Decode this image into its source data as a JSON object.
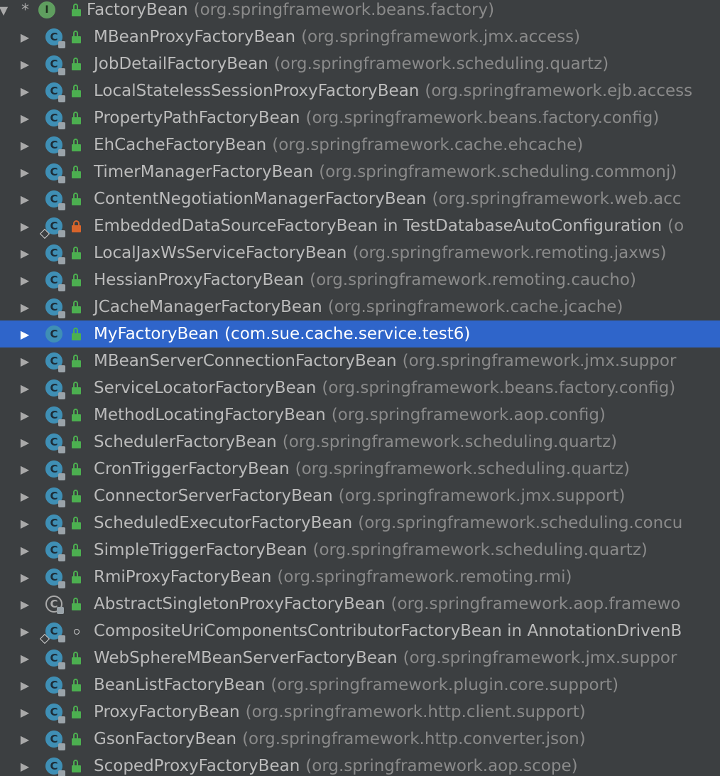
{
  "colors": {
    "background": "#3c3f41",
    "selection": "#2f65ca",
    "text": "#bbbbbb",
    "package_text": "#8a8a8a",
    "class_icon": "#3f8fb5",
    "interface_icon": "#5f9e5f",
    "public_lock": "#4caf50",
    "private_lock": "#d8642b"
  },
  "root": {
    "expand_icon": "chevron-down-icon",
    "marker": "*",
    "icon": "interface-icon",
    "icon_letter": "I",
    "visibility": "public",
    "name": "FactoryBean",
    "pkg": "(org.springframework.beans.factory)"
  },
  "rows": [
    {
      "name": "MBeanProxyFactoryBean",
      "pkg": "(org.springframework.jmx.access)",
      "icon": "class",
      "visibility": "public"
    },
    {
      "name": "JobDetailFactoryBean",
      "pkg": "(org.springframework.scheduling.quartz)",
      "icon": "class",
      "visibility": "public"
    },
    {
      "name": "LocalStatelessSessionProxyFactoryBean",
      "pkg": "(org.springframework.ejb.access",
      "icon": "class",
      "visibility": "public"
    },
    {
      "name": "PropertyPathFactoryBean",
      "pkg": "(org.springframework.beans.factory.config)",
      "icon": "class",
      "visibility": "public"
    },
    {
      "name": "EhCacheFactoryBean",
      "pkg": "(org.springframework.cache.ehcache)",
      "icon": "class",
      "visibility": "public"
    },
    {
      "name": "TimerManagerFactoryBean",
      "pkg": "(org.springframework.scheduling.commonj)",
      "icon": "class",
      "visibility": "public"
    },
    {
      "name": "ContentNegotiationManagerFactoryBean",
      "pkg": "(org.springframework.web.acc",
      "icon": "class",
      "visibility": "public"
    },
    {
      "name": "EmbeddedDataSourceFactoryBean in TestDatabaseAutoConfiguration",
      "pkg": "(o",
      "icon": "class-inner",
      "visibility": "private",
      "name_full": true
    },
    {
      "name": "LocalJaxWsServiceFactoryBean",
      "pkg": "(org.springframework.remoting.jaxws)",
      "icon": "class",
      "visibility": "public"
    },
    {
      "name": "HessianProxyFactoryBean",
      "pkg": "(org.springframework.remoting.caucho)",
      "icon": "class",
      "visibility": "public"
    },
    {
      "name": "JCacheManagerFactoryBean",
      "pkg": "(org.springframework.cache.jcache)",
      "icon": "class",
      "visibility": "public"
    },
    {
      "name": "MyFactoryBean",
      "pkg": "(com.sue.cache.service.test6)",
      "icon": "class-plain",
      "visibility": "public",
      "selected": true
    },
    {
      "name": "MBeanServerConnectionFactoryBean",
      "pkg": "(org.springframework.jmx.suppor",
      "icon": "class",
      "visibility": "public"
    },
    {
      "name": "ServiceLocatorFactoryBean",
      "pkg": "(org.springframework.beans.factory.config)",
      "icon": "class",
      "visibility": "public"
    },
    {
      "name": "MethodLocatingFactoryBean",
      "pkg": "(org.springframework.aop.config)",
      "icon": "class",
      "visibility": "public"
    },
    {
      "name": "SchedulerFactoryBean",
      "pkg": "(org.springframework.scheduling.quartz)",
      "icon": "class",
      "visibility": "public"
    },
    {
      "name": "CronTriggerFactoryBean",
      "pkg": "(org.springframework.scheduling.quartz)",
      "icon": "class",
      "visibility": "public"
    },
    {
      "name": "ConnectorServerFactoryBean",
      "pkg": "(org.springframework.jmx.support)",
      "icon": "class",
      "visibility": "public"
    },
    {
      "name": "ScheduledExecutorFactoryBean",
      "pkg": "(org.springframework.scheduling.concu",
      "icon": "class",
      "visibility": "public"
    },
    {
      "name": "SimpleTriggerFactoryBean",
      "pkg": "(org.springframework.scheduling.quartz)",
      "icon": "class",
      "visibility": "public"
    },
    {
      "name": "RmiProxyFactoryBean",
      "pkg": "(org.springframework.remoting.rmi)",
      "icon": "class",
      "visibility": "public"
    },
    {
      "name": "AbstractSingletonProxyFactoryBean",
      "pkg": "(org.springframework.aop.framewo",
      "icon": "abstract-class",
      "visibility": "public"
    },
    {
      "name": "CompositeUriComponentsContributorFactoryBean in AnnotationDrivenB",
      "pkg": "",
      "icon": "class-inner",
      "visibility": "package"
    },
    {
      "name": "WebSphereMBeanServerFactoryBean",
      "pkg": "(org.springframework.jmx.suppor",
      "icon": "class",
      "visibility": "public"
    },
    {
      "name": "BeanListFactoryBean",
      "pkg": "(org.springframework.plugin.core.support)",
      "icon": "class",
      "visibility": "public"
    },
    {
      "name": "ProxyFactoryBean",
      "pkg": "(org.springframework.http.client.support)",
      "icon": "class",
      "visibility": "public"
    },
    {
      "name": "GsonFactoryBean",
      "pkg": "(org.springframework.http.converter.json)",
      "icon": "class",
      "visibility": "public"
    },
    {
      "name": "ScopedProxyFactoryBean",
      "pkg": "(org.springframework.aop.scope)",
      "icon": "class",
      "visibility": "public"
    }
  ]
}
